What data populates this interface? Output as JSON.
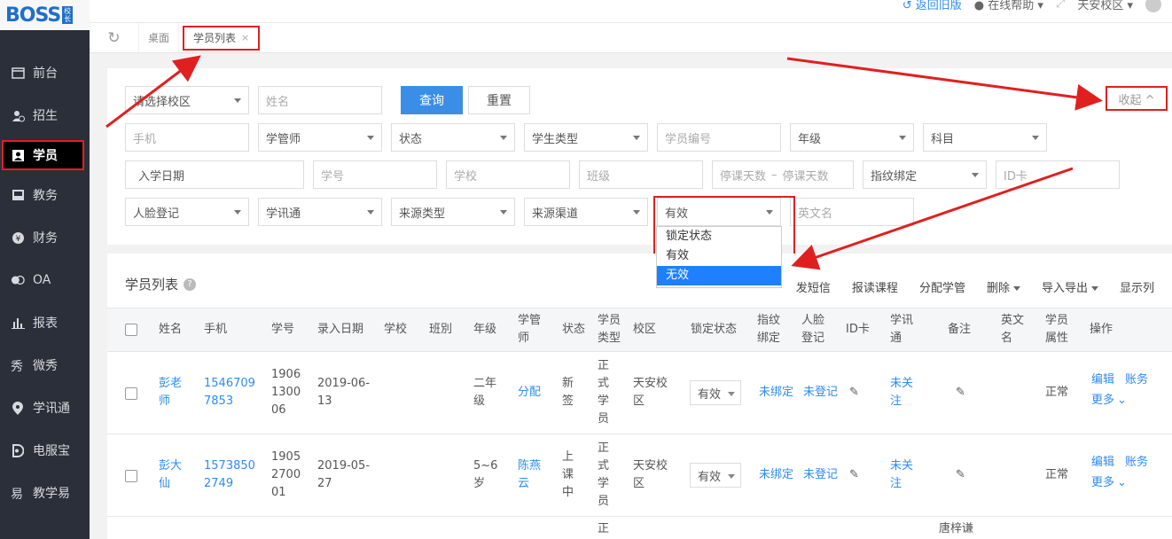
{
  "logo": {
    "text": "BOSS",
    "badge": "校长"
  },
  "sidebar": {
    "items": [
      {
        "label": "前台",
        "icon": "calendar-icon"
      },
      {
        "label": "招生",
        "icon": "add-user-icon"
      },
      {
        "label": "学员",
        "icon": "student-card-icon",
        "active": true
      },
      {
        "label": "教务",
        "icon": "book-icon"
      },
      {
        "label": "财务",
        "icon": "yen-icon"
      },
      {
        "label": "OA",
        "icon": "toggle-icon"
      },
      {
        "label": "报表",
        "icon": "bar-chart-icon"
      },
      {
        "label": "微秀",
        "icon": "weixiu-icon"
      },
      {
        "label": "学讯通",
        "icon": "location-pin-icon"
      },
      {
        "label": "电服宝",
        "icon": "phone-icon"
      },
      {
        "label": "教学易",
        "icon": "teach-icon"
      }
    ]
  },
  "header": {
    "back_old": "返回旧版",
    "online_help": "在线帮助",
    "campus": "天安校区"
  },
  "tabs": {
    "desktop": "桌面",
    "student_list": "学员列表",
    "close": "×"
  },
  "filters": {
    "campus_placeholder": "请选择校区",
    "name_placeholder": "姓名",
    "query_label": "查询",
    "reset_label": "重置",
    "collapse_label": "收起 ^",
    "phone_placeholder": "手机",
    "manager": "学管师",
    "status": "状态",
    "student_type": "学生类型",
    "student_no_placeholder": "学员编号",
    "grade": "年级",
    "subject": "科目",
    "enroll_date": "入学日期",
    "xuehao_placeholder": "学号",
    "school_placeholder": "学校",
    "class_placeholder": "班级",
    "stop_days_from": "停课天数",
    "stop_days_sep": "–",
    "stop_days_to": "停课天数",
    "fingerprint": "指纹绑定",
    "idcard_placeholder": "ID卡",
    "face": "人脸登记",
    "xuexuntong": "学讯通",
    "source_type": "来源类型",
    "source_channel": "来源渠道",
    "lock_selected": "有效",
    "english_name_placeholder": "英文名",
    "lock_options": [
      "锁定状态",
      "有效",
      "无效"
    ]
  },
  "list": {
    "title": "学员列表",
    "help": "?",
    "toolbar": {
      "sms": "发短信",
      "enroll_course": "报读课程",
      "assign_manager": "分配学管",
      "delete": "删除",
      "import_export": "导入导出",
      "show_columns": "显示列"
    },
    "columns": {
      "name": "姓名",
      "phone": "手机",
      "xuehao": "学号",
      "entry_date": "录入日期",
      "school": "学校",
      "class": "班別",
      "grade": "年级",
      "manager": "学管\n师",
      "status": "状态",
      "type": "学员\n类型",
      "campus": "校区",
      "lock": "锁定状态",
      "fingerprint": "指纹\n绑定",
      "face": "人脸\n登记",
      "idcard": "ID卡",
      "xxt": "学讯\n通",
      "remark": "备注",
      "english": "英文\n名",
      "attr": "学员\n属性",
      "ops": "操作"
    },
    "rows": [
      {
        "name": "彭老\n师",
        "phone": "1546709\n7853",
        "xuehao": "1906\n1300\n06",
        "entry_date": "2019-06-\n13",
        "grade": "二年\n级",
        "manager": "分配",
        "status": "新\n签",
        "type": "正\n式\n学\n员",
        "campus": "天安校\n区",
        "lock": "有效",
        "fingerprint": "未绑定",
        "face": "未登记",
        "xxt": "未关\n注",
        "attr": "正常",
        "edit": "编辑",
        "account": "账务",
        "more": "更多"
      },
      {
        "name": "彭大\n仙",
        "phone": "1573850\n2749",
        "xuehao": "1905\n2700\n01",
        "entry_date": "2019-05-\n27",
        "grade": "5~6\n岁",
        "manager": "陈燕\n云",
        "status": "上\n课\n中",
        "type": "正\n式\n学\n员",
        "campus": "天安校\n区",
        "lock": "有效",
        "fingerprint": "未绑定",
        "face": "未登记",
        "xxt": "未关\n注",
        "attr": "正常",
        "edit": "编辑",
        "account": "账务",
        "more": "更多"
      },
      {
        "type": "正",
        "remark": "唐梓谦"
      }
    ]
  },
  "colors": {
    "accent": "#2d8cf0",
    "primary_button": "#3a8ee6",
    "annotation": "#e02020",
    "sidebar": "#2b2f3a"
  }
}
